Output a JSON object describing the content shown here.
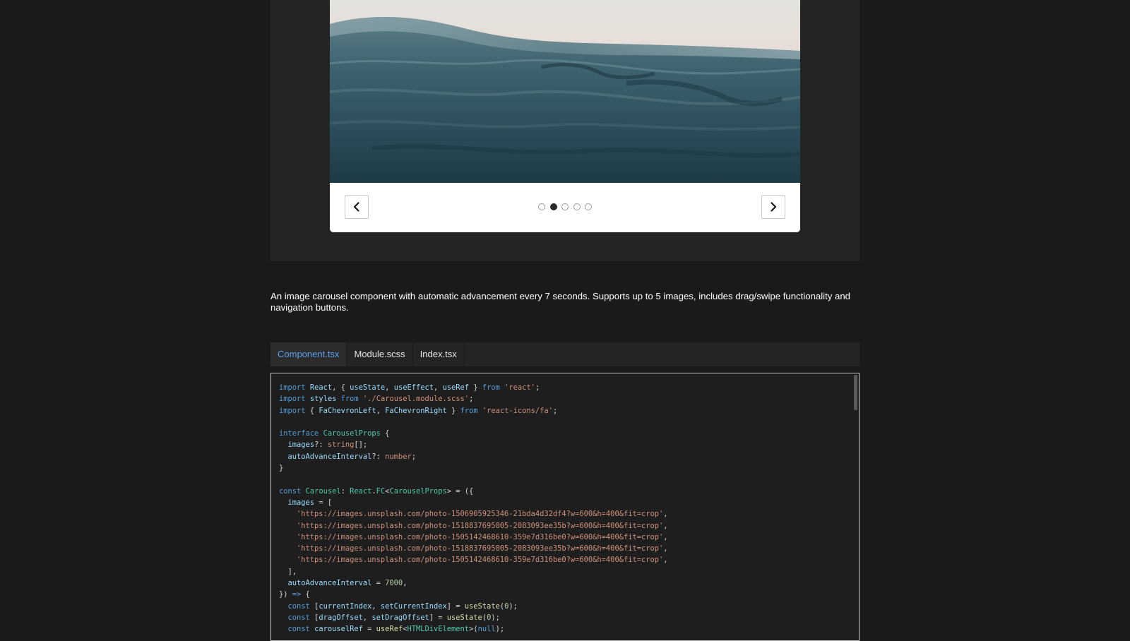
{
  "carousel": {
    "image_alt": "Ocean waves at dusk",
    "prev_icon": "chevron-left-icon",
    "next_icon": "chevron-right-icon",
    "dot_count": 5,
    "active_index": 1
  },
  "description": "An image carousel component with automatic advancement every 7 seconds. Supports up to 5 images, includes drag/swipe functionality and navigation buttons.",
  "tabs": [
    {
      "label": "Component.tsx",
      "active": true
    },
    {
      "label": "Module.scss",
      "active": false
    },
    {
      "label": "Index.tsx",
      "active": false
    }
  ],
  "code": {
    "lines": [
      [
        [
          "kw",
          "import"
        ],
        [
          "pt",
          " "
        ],
        [
          "vr",
          "React"
        ],
        [
          "pt",
          ", { "
        ],
        [
          "vr",
          "useState"
        ],
        [
          "pt",
          ", "
        ],
        [
          "vr",
          "useEffect"
        ],
        [
          "pt",
          ", "
        ],
        [
          "vr",
          "useRef"
        ],
        [
          "pt",
          " } "
        ],
        [
          "kw",
          "from"
        ],
        [
          "pt",
          " "
        ],
        [
          "st",
          "'react'"
        ],
        [
          "pt",
          ";"
        ]
      ],
      [
        [
          "kw",
          "import"
        ],
        [
          "pt",
          " "
        ],
        [
          "vr",
          "styles"
        ],
        [
          "pt",
          " "
        ],
        [
          "kw",
          "from"
        ],
        [
          "pt",
          " "
        ],
        [
          "st",
          "'./Carousel.module.scss'"
        ],
        [
          "pt",
          ";"
        ]
      ],
      [
        [
          "kw",
          "import"
        ],
        [
          "pt",
          " { "
        ],
        [
          "vr",
          "FaChevronLeft"
        ],
        [
          "pt",
          ", "
        ],
        [
          "vr",
          "FaChevronRight"
        ],
        [
          "pt",
          " } "
        ],
        [
          "kw",
          "from"
        ],
        [
          "pt",
          " "
        ],
        [
          "st",
          "'react-icons/fa'"
        ],
        [
          "pt",
          ";"
        ]
      ],
      [],
      [
        [
          "kw",
          "interface"
        ],
        [
          "pt",
          " "
        ],
        [
          "ty",
          "CarouselProps"
        ],
        [
          "pt",
          " {"
        ]
      ],
      [
        [
          "pt",
          "  "
        ],
        [
          "vr",
          "images"
        ],
        [
          "pt",
          "?: "
        ],
        [
          "st",
          "string"
        ],
        [
          "pt",
          "[];"
        ]
      ],
      [
        [
          "pt",
          "  "
        ],
        [
          "vr",
          "autoAdvanceInterval"
        ],
        [
          "pt",
          "?: "
        ],
        [
          "st",
          "number"
        ],
        [
          "pt",
          ";"
        ]
      ],
      [
        [
          "pt",
          "}"
        ]
      ],
      [],
      [
        [
          "kw",
          "const"
        ],
        [
          "pt",
          " "
        ],
        [
          "ty",
          "Carousel"
        ],
        [
          "pt",
          ": "
        ],
        [
          "ty",
          "React"
        ],
        [
          "pt",
          "."
        ],
        [
          "ty",
          "FC"
        ],
        [
          "pt",
          "<"
        ],
        [
          "ty",
          "CarouselProps"
        ],
        [
          "pt",
          "> = ({"
        ]
      ],
      [
        [
          "pt",
          "  "
        ],
        [
          "vr",
          "images"
        ],
        [
          "pt",
          " = ["
        ]
      ],
      [
        [
          "pt",
          "    "
        ],
        [
          "st",
          "'https://images.unsplash.com/photo-1506905925346-21bda4d32df4?w=600&h=400&fit=crop'"
        ],
        [
          "pt",
          ","
        ]
      ],
      [
        [
          "pt",
          "    "
        ],
        [
          "st",
          "'https://images.unsplash.com/photo-1518837695005-2083093ee35b?w=600&h=400&fit=crop'"
        ],
        [
          "pt",
          ","
        ]
      ],
      [
        [
          "pt",
          "    "
        ],
        [
          "st",
          "'https://images.unsplash.com/photo-1505142468610-359e7d316be0?w=600&h=400&fit=crop'"
        ],
        [
          "pt",
          ","
        ]
      ],
      [
        [
          "pt",
          "    "
        ],
        [
          "st",
          "'https://images.unsplash.com/photo-1518837695005-2083093ee35b?w=600&h=400&fit=crop'"
        ],
        [
          "pt",
          ","
        ]
      ],
      [
        [
          "pt",
          "    "
        ],
        [
          "st",
          "'https://images.unsplash.com/photo-1505142468610-359e7d316be0?w=600&h=400&fit=crop'"
        ],
        [
          "pt",
          ","
        ]
      ],
      [
        [
          "pt",
          "  ],"
        ]
      ],
      [
        [
          "pt",
          "  "
        ],
        [
          "vr",
          "autoAdvanceInterval"
        ],
        [
          "pt",
          " = "
        ],
        [
          "nm",
          "7000"
        ],
        [
          "pt",
          ","
        ]
      ],
      [
        [
          "pt",
          "}) "
        ],
        [
          "kw",
          "=>"
        ],
        [
          "pt",
          " {"
        ]
      ],
      [
        [
          "pt",
          "  "
        ],
        [
          "kw",
          "const"
        ],
        [
          "pt",
          " ["
        ],
        [
          "vr",
          "currentIndex"
        ],
        [
          "pt",
          ", "
        ],
        [
          "vr",
          "setCurrentIndex"
        ],
        [
          "pt",
          "] = "
        ],
        [
          "fn",
          "useState"
        ],
        [
          "pt",
          "("
        ],
        [
          "nm",
          "0"
        ],
        [
          "pt",
          ");"
        ]
      ],
      [
        [
          "pt",
          "  "
        ],
        [
          "kw",
          "const"
        ],
        [
          "pt",
          " ["
        ],
        [
          "vr",
          "dragOffset"
        ],
        [
          "pt",
          ", "
        ],
        [
          "vr",
          "setDragOffset"
        ],
        [
          "pt",
          "] = "
        ],
        [
          "fn",
          "useState"
        ],
        [
          "pt",
          "("
        ],
        [
          "nm",
          "0"
        ],
        [
          "pt",
          ");"
        ]
      ],
      [
        [
          "pt",
          "  "
        ],
        [
          "kw",
          "const"
        ],
        [
          "pt",
          " "
        ],
        [
          "vr",
          "carouselRef"
        ],
        [
          "pt",
          " = "
        ],
        [
          "fn",
          "useRef"
        ],
        [
          "pt",
          "<"
        ],
        [
          "ty",
          "HTMLDivElement"
        ],
        [
          "pt",
          ">("
        ],
        [
          "kw",
          "null"
        ],
        [
          "pt",
          ");"
        ]
      ]
    ]
  },
  "colors": {
    "page_bg": "#1a1a1a",
    "panel_bg": "#242424",
    "tab_active": "#5aa0f0",
    "code_bg": "#1e1e1e"
  }
}
